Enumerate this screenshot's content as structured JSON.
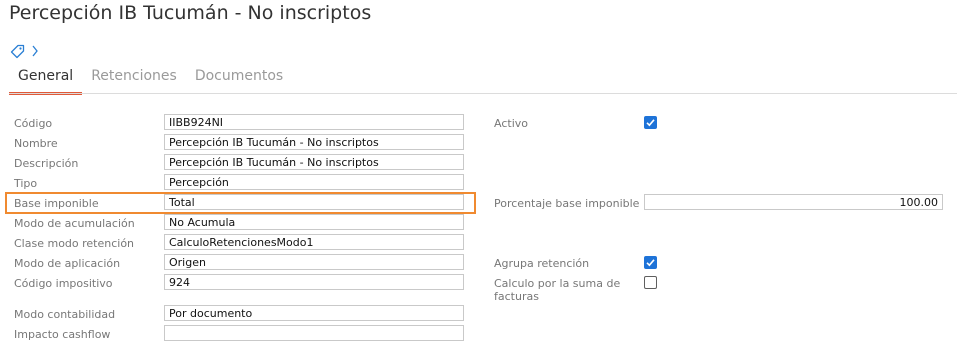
{
  "title": "Percepción IB Tucumán - No inscriptos",
  "icons": {
    "tag": "tag-icon",
    "chevron": "chevron-right-icon"
  },
  "tabs": [
    {
      "label": "General",
      "active": true
    },
    {
      "label": "Retenciones",
      "active": false
    },
    {
      "label": "Documentos",
      "active": false
    }
  ],
  "fields": {
    "codigo": {
      "label": "Código",
      "value": "IIBB924NI"
    },
    "nombre": {
      "label": "Nombre",
      "value": "Percepción IB Tucumán - No inscriptos"
    },
    "descripcion": {
      "label": "Descripción",
      "value": "Percepción IB Tucumán - No inscriptos"
    },
    "tipo": {
      "label": "Tipo",
      "value": "Percepción"
    },
    "base_imponible": {
      "label": "Base imponible",
      "value": "Total"
    },
    "modo_acumulacion": {
      "label": "Modo de acumulación",
      "value": "No Acumula"
    },
    "clase_modo_retencion": {
      "label": "Clase modo retención",
      "value": "CalculoRetencionesModo1"
    },
    "modo_aplicacion": {
      "label": "Modo de aplicación",
      "value": "Origen"
    },
    "codigo_impositivo": {
      "label": "Código impositivo",
      "value": "924"
    },
    "modo_contabilidad": {
      "label": "Modo contabilidad",
      "value": "Por documento"
    },
    "impacto_cashflow": {
      "label": "Impacto cashflow",
      "value": ""
    }
  },
  "right": {
    "activo": {
      "label": "Activo",
      "checked": true
    },
    "porcentaje": {
      "label": "Porcentaje base imponible",
      "value": "100.00"
    },
    "agrupa": {
      "label": "Agrupa retención",
      "checked": true
    },
    "calculo_line1": "Calculo por la suma de",
    "calculo_line2": "facturas",
    "calculo_checked": false
  },
  "colors": {
    "accent_tab": "#e05a3a",
    "checkbox": "#1e73d8",
    "highlight": "#f08a30"
  }
}
